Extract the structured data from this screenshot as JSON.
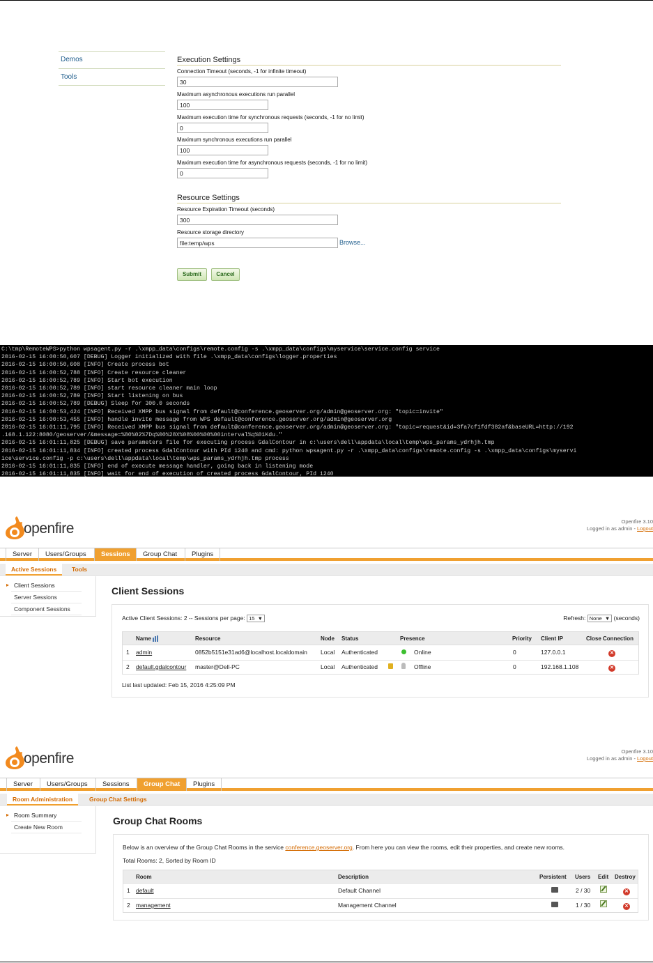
{
  "wps": {
    "nav": [
      {
        "label": "Demos"
      },
      {
        "label": "Tools"
      }
    ],
    "execution": {
      "title": "Execution Settings",
      "fields": [
        {
          "label": "Connection Timeout (seconds, -1 for infinite timeout)",
          "value": "30"
        },
        {
          "label": "Maximum asynchronous executions run parallel",
          "value": "100"
        },
        {
          "label": "Maximum execution time for synchronous requests (seconds, -1 for no limit)",
          "value": "0"
        },
        {
          "label": "Maximum synchronous executions run parallel",
          "value": "100"
        },
        {
          "label": "Maximum execution time for asynchronous requests (seconds, -1 for no limit)",
          "value": "0"
        }
      ]
    },
    "resource": {
      "title": "Resource Settings",
      "fields": [
        {
          "label": "Resource Expiration Timeout (seconds)",
          "value": "300"
        },
        {
          "label": "Resource storage directory",
          "value": "file:temp/wps"
        }
      ],
      "browse": "Browse..."
    },
    "submit": "Submit",
    "cancel": "Cancel"
  },
  "console": {
    "lines": [
      "C:\\tmp\\RemoteWPS>python wpsagent.py -r .\\xmpp_data\\configs\\remote.config -s .\\xmpp_data\\configs\\myservice\\service.config service",
      "2016-02-15 16:00:50,607 [DEBUG] Logger initialized with file .\\xmpp_data\\configs\\logger.properties",
      "2016-02-15 16:00:50,608 [INFO] Create process bot",
      "2016-02-15 16:00:52,788 [INFO] Create resource cleaner",
      "2016-02-15 16:00:52,789 [INFO] Start bot execution",
      "2016-02-15 16:00:52,789 [INFO] start resource cleaner main loop",
      "2016-02-15 16:00:52,789 [INFO] Start listening on bus",
      "2016-02-15 16:00:52,789 [DEBUG] Sleep for 300.0 seconds",
      "2016-02-15 16:00:53,424 [INFO] Received XMPP bus signal from default@conference.geoserver.org/admin@geoserver.org: \"topic=invite\"",
      "2016-02-15 16:00:53,455 [INFO] handle invite message from WPS default@conference.geoserver.org/admin@geoserver.org",
      "2016-02-15 16:01:11,795 [INFO] Received XMPP bus signal from default@conference.geoserver.org/admin@geoserver.org: \"topic=request&id=3fa7cf1fdf382af&baseURL=http://192",
      ".168.1.122:8080/geoserver/&message=%80%02%7Dq%00%28X%08%00%00%00interval%q%01Kdu.\"",
      "2016-02-15 16:01:11,825 [DEBUG] save parameters file for executing process GdalContour in c:\\users\\dell\\appdata\\local\\temp\\wps_params_ydrhjh.tmp",
      "2016-02-15 16:01:11,834 [INFO] created process GdalContour with PId 1240 and cmd: python wpsagent.py -r .\\xmpp_data\\configs\\remote.config -s .\\xmpp_data\\configs\\myservi",
      "ice\\service.config -p c:\\users\\dell\\appdata\\local\\temp\\wps_params_ydrhjh.tmp process",
      "2016-02-15 16:01:11,835 [INFO] end of execute message handler, going back in listening mode",
      "2016-02-15 16:01:11,835 [INFO] wait for end of execution of created process GdalContour, PId 1240"
    ]
  },
  "sessions": {
    "logo": "openfire",
    "version": "Openfire 3.10",
    "logged_in": "Logged in as admin - ",
    "logout": "Logout",
    "tabs": [
      "Server",
      "Users/Groups",
      "Sessions",
      "Group Chat",
      "Plugins"
    ],
    "subtabs": [
      "Active Sessions",
      "Tools"
    ],
    "side": [
      "Client Sessions",
      "Server Sessions",
      "Component Sessions"
    ],
    "title": "Client Sessions",
    "summary": "Active Client Sessions: 2 -- Sessions per page:",
    "per_page": "15",
    "refresh_label": "Refresh:",
    "refresh_value": "None",
    "refresh_unit": "(seconds)",
    "columns": [
      "Name",
      "Resource",
      "Node",
      "Status",
      "Presence",
      "Priority",
      "Client IP",
      "Close Connection"
    ],
    "rows": [
      {
        "num": "1",
        "name": "admin",
        "resource": "0852b5151e31ad6@localhost.localdomain",
        "node": "Local",
        "status": "Authenticated",
        "presence": "Online",
        "priority": "0",
        "ip": "127.0.0.1"
      },
      {
        "num": "2",
        "name": "default.gdalcontour",
        "resource": "master@Dell-PC",
        "node": "Local",
        "status": "Authenticated",
        "presence": "Offline",
        "priority": "0",
        "ip": "192.168.1.108"
      }
    ],
    "updated": "List last updated: Feb 15, 2016 4:25:09 PM"
  },
  "groupchat": {
    "logo": "openfire",
    "version": "Openfire 3.10",
    "logged_in": "Logged in as admin - ",
    "logout": "Logout",
    "tabs": [
      "Server",
      "Users/Groups",
      "Sessions",
      "Group Chat",
      "Plugins"
    ],
    "subtabs": [
      "Room Administration",
      "Group Chat Settings"
    ],
    "side": [
      "Room Summary",
      "Create New Room"
    ],
    "title": "Group Chat Rooms",
    "intro_pre": "Below is an overview of the Group Chat Rooms in the service ",
    "intro_link": "conference.geoserver.org",
    "intro_post": ". From here you can view the rooms, edit their properties, and create new rooms.",
    "total": "Total Rooms: 2, Sorted by Room ID",
    "columns": [
      "Room",
      "Description",
      "Persistent",
      "Users",
      "Edit",
      "Destroy"
    ],
    "rows": [
      {
        "num": "1",
        "room": "default",
        "description": "Default Channel",
        "users": "2 / 30"
      },
      {
        "num": "2",
        "room": "management",
        "description": "Management Channel",
        "users": "1 / 30"
      }
    ]
  }
}
